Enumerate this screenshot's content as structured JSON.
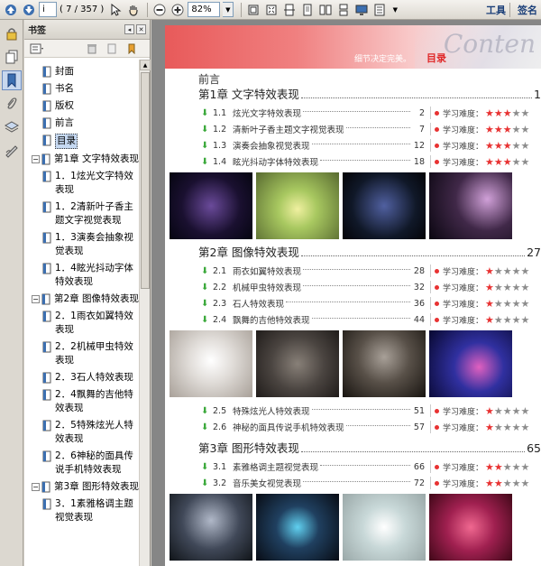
{
  "toolbar": {
    "page_value": "i",
    "page_count": "( 7 / 357 )",
    "zoom": "82%",
    "tools_label": "工具",
    "sign_label": "签名"
  },
  "bookmarks": {
    "title": "书签",
    "items": [
      {
        "label": "封面",
        "level": 1,
        "exp": ""
      },
      {
        "label": "书名",
        "level": 1,
        "exp": ""
      },
      {
        "label": "版权",
        "level": 1,
        "exp": ""
      },
      {
        "label": "前言",
        "level": 1,
        "exp": ""
      },
      {
        "label": "目录",
        "level": 1,
        "exp": "",
        "selected": true
      },
      {
        "label": "第1章 文字特效表现",
        "level": 0,
        "exp": "−"
      },
      {
        "label": "1．1炫光文字特效表现",
        "level": 1,
        "exp": ""
      },
      {
        "label": "1．2清新叶子香主题文字视觉表现",
        "level": 1,
        "exp": ""
      },
      {
        "label": "1．3演奏会抽象视觉表现",
        "level": 1,
        "exp": ""
      },
      {
        "label": "1．4眩光抖动字体特效表现",
        "level": 1,
        "exp": ""
      },
      {
        "label": "第2章 图像特效表现",
        "level": 0,
        "exp": "−"
      },
      {
        "label": "2．1雨衣如翼特效表现",
        "level": 1,
        "exp": ""
      },
      {
        "label": "2．2机械甲虫特效表现",
        "level": 1,
        "exp": ""
      },
      {
        "label": "2．3石人特效表现",
        "level": 1,
        "exp": ""
      },
      {
        "label": "2．4飘舞的吉他特效表现",
        "level": 1,
        "exp": ""
      },
      {
        "label": "2．5特殊炫光人特效表现",
        "level": 1,
        "exp": ""
      },
      {
        "label": "2．6神秘的面具传说手机特效表现",
        "level": 1,
        "exp": ""
      },
      {
        "label": "第3章 图形特效表现",
        "level": 0,
        "exp": "−"
      },
      {
        "label": "3．1素雅格调主题视觉表现",
        "level": 1,
        "exp": ""
      }
    ]
  },
  "page": {
    "slogan": "细节决定完美。",
    "mulu": "目录",
    "script": "Conten",
    "preface": "前言",
    "diff_label": "学习难度：",
    "chapters": [
      {
        "title": "第1章 文字特效表现",
        "page": "1",
        "entries": [
          {
            "num": "1.1",
            "title": "炫光文字特效表现",
            "page": "2",
            "stars": 3
          },
          {
            "num": "1.2",
            "title": "清新叶子香主题文字视觉表现",
            "page": "7",
            "stars": 3
          },
          {
            "num": "1.3",
            "title": "演奏会抽象视觉表现",
            "page": "12",
            "stars": 3
          },
          {
            "num": "1.4",
            "title": "眩光抖动字体特效表现",
            "page": "18",
            "stars": 3
          }
        ]
      },
      {
        "title": "第2章 图像特效表现",
        "page": "27",
        "entries": [
          {
            "num": "2.1",
            "title": "雨衣如翼特效表现",
            "page": "28",
            "stars": 1
          },
          {
            "num": "2.2",
            "title": "机械甲虫特效表现",
            "page": "32",
            "stars": 1
          },
          {
            "num": "2.3",
            "title": "石人特效表现",
            "page": "36",
            "stars": 1
          },
          {
            "num": "2.4",
            "title": "飘舞的吉他特效表现",
            "page": "44",
            "stars": 1
          }
        ],
        "entries_b": [
          {
            "num": "2.5",
            "title": "特殊炫光人特效表现",
            "page": "51",
            "stars": 1
          },
          {
            "num": "2.6",
            "title": "神秘的面具传说手机特效表现",
            "page": "57",
            "stars": 1
          }
        ]
      },
      {
        "title": "第3章 图形特效表现",
        "page": "65",
        "entries": [
          {
            "num": "3.1",
            "title": "素雅格调主题视觉表现",
            "page": "66",
            "stars": 2
          },
          {
            "num": "3.2",
            "title": "音乐美女视觉表现",
            "page": "72",
            "stars": 2
          }
        ]
      }
    ]
  }
}
